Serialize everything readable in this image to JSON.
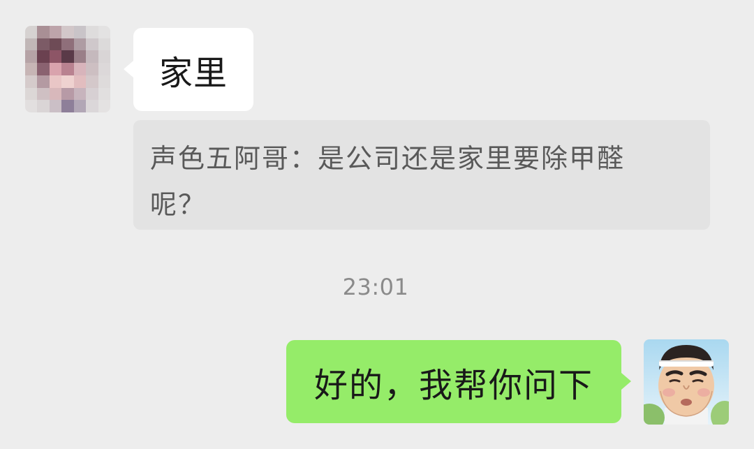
{
  "chat": {
    "incoming_message": "家里",
    "quote_text": "声色五阿哥：是公司还是家里要除甲醛呢？",
    "timestamp": "23:01",
    "outgoing_message": "好的，我帮你问下"
  },
  "avatars": {
    "left": "contact-avatar-pixelated",
    "right": "cartoon-face-avatar"
  },
  "colors": {
    "background": "#ededed",
    "incoming_bubble": "#ffffff",
    "outgoing_bubble": "#95ec69",
    "quote_block": "#e3e3e3",
    "quote_text": "#595959",
    "timestamp_text": "#8a8a8a"
  }
}
